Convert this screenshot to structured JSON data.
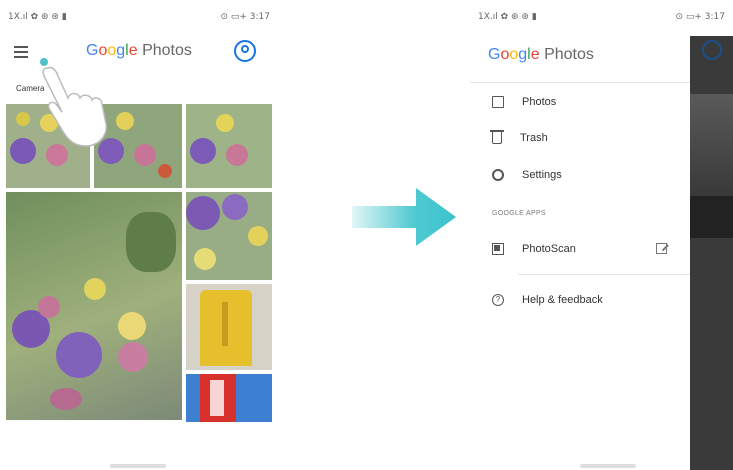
{
  "status_bar": {
    "left": "1X.ıl ✿ ⊛ ⊛ ▮",
    "right": "⊙ ▭+ 3:17"
  },
  "left_screen": {
    "app_title": {
      "G": "G",
      "o1": "o",
      "o2": "o",
      "g": "g",
      "l": "l",
      "e": "e",
      "rest": " Photos"
    },
    "album_label": "Camera",
    "photos": [
      "roses-1",
      "roses-2",
      "roses-3",
      "roses-large",
      "roses-4",
      "yellow-toy",
      "kfc-box"
    ]
  },
  "right_screen": {
    "drawer_title": {
      "G": "G",
      "o1": "o",
      "o2": "o",
      "g": "g",
      "l": "l",
      "e": "e",
      "rest": " Photos"
    },
    "menu": [
      {
        "label": "Photos",
        "icon": "photos-icon"
      },
      {
        "label": "Trash",
        "icon": "trash-icon"
      },
      {
        "label": "Settings",
        "icon": "settings-icon"
      }
    ],
    "section": "GOOGLE APPS",
    "photoscan": {
      "label": "PhotoScan",
      "icon": "photoscan-icon",
      "trailing_icon": "open-external-icon"
    },
    "help": {
      "label": "Help & feedback",
      "icon": "help-icon"
    }
  },
  "colors": {
    "arrow": "#3cc3cc",
    "google_blue": "#4285F4",
    "google_red": "#EA4335",
    "google_yellow": "#FBBC05",
    "google_green": "#34A853"
  }
}
